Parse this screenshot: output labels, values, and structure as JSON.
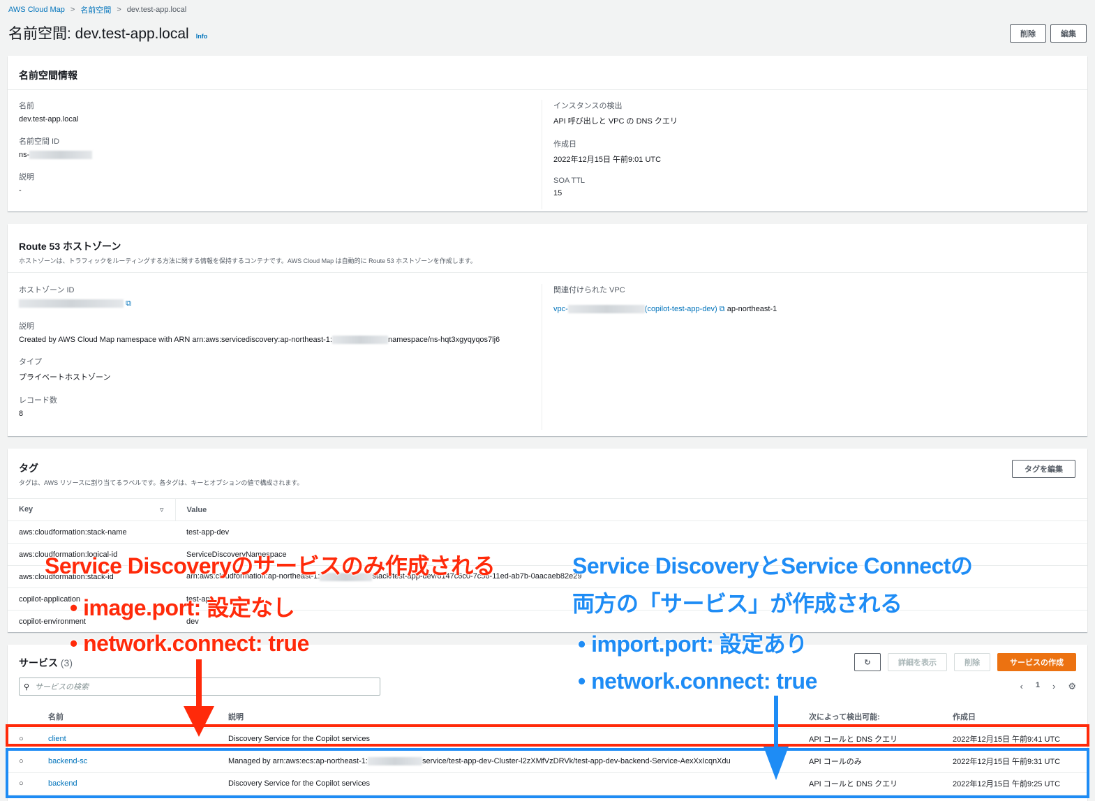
{
  "breadcrumb": [
    "AWS Cloud Map",
    "名前空間",
    "dev.test-app.local"
  ],
  "title": "名前空間: dev.test-app.local",
  "info": "Info",
  "header_buttons": {
    "delete": "削除",
    "edit": "編集"
  },
  "ns_info": {
    "heading": "名前空間情報",
    "left": [
      {
        "k": "名前",
        "v": "dev.test-app.local"
      },
      {
        "k": "名前空間 ID",
        "v": "ns-"
      },
      {
        "k": "説明",
        "v": "-"
      }
    ],
    "right": [
      {
        "k": "インスタンスの検出",
        "v": "API 呼び出しと VPC の DNS クエリ"
      },
      {
        "k": "作成日",
        "v": "2022年12月15日 午前9:01 UTC"
      },
      {
        "k": "SOA TTL",
        "v": "15"
      }
    ]
  },
  "route53": {
    "heading": "Route 53 ホストゾーン",
    "desc": "ホストゾーンは、トラフィックをルーティングする方法に関する情報を保持するコンテナです。AWS Cloud Map は自動的に Route 53 ホストゾーンを作成します。",
    "zone_id_label": "ホストゾーン ID",
    "desc_label": "説明",
    "desc_value_a": "Created by AWS Cloud Map namespace with ARN arn:aws:servicediscovery:ap-northeast-1:",
    "desc_value_b": "namespace/ns-hqt3xgyqyqos7lj6",
    "type_label": "タイプ",
    "type_value": "プライベートホストゾーン",
    "records_label": "レコード数",
    "records_value": "8",
    "vpc_label": "関連付けられた VPC",
    "vpc_prefix": "vpc-",
    "vpc_name": "(copilot-test-app-dev)",
    "vpc_region": "ap-northeast-1"
  },
  "tags": {
    "heading": "タグ",
    "desc": "タグは、AWS リソースに割り当てるラベルです。各タグは、キーとオプションの値で構成されます。",
    "edit": "タグを編集",
    "col_key": "Key",
    "col_value": "Value",
    "rows": [
      {
        "k": "aws:cloudformation:stack-name",
        "v": "test-app-dev"
      },
      {
        "k": "aws:cloudformation:logical-id",
        "v": "ServiceDiscoveryNamespace"
      },
      {
        "k": "aws:cloudformation:stack-id",
        "v": "arn:aws:cloudformation:ap-northeast-1:",
        "v2": "stack/test-app-dev/6147c6c0-7c56-11ed-ab7b-0aacaeb82e29"
      },
      {
        "k": "copilot-application",
        "v": "test-app"
      },
      {
        "k": "copilot-environment",
        "v": "dev"
      }
    ]
  },
  "services": {
    "heading": "サービス",
    "count": "(3)",
    "details": "詳細を表示",
    "delete": "削除",
    "create": "サービスの作成",
    "search_placeholder": "サービスの検索",
    "page": "1",
    "cols": [
      "名前",
      "説明",
      "次によって検出可能:",
      "作成日"
    ],
    "rows": [
      {
        "name": "client",
        "desc": "Discovery Service for the Copilot services",
        "disc": "API コールと DNS クエリ",
        "date": "2022年12月15日 午前9:41 UTC"
      },
      {
        "name": "backend-sc",
        "desc": "Managed by arn:aws:ecs:ap-northeast-1:",
        "desc2": "service/test-app-dev-Cluster-l2zXMfVzDRVk/test-app-dev-backend-Service-AexXxIcqnXdu",
        "disc": "API コールのみ",
        "date": "2022年12月15日 午前9:31 UTC"
      },
      {
        "name": "backend",
        "desc": "Discovery Service for the Copilot services",
        "disc": "API コールと DNS クエリ",
        "date": "2022年12月15日 午前9:25 UTC"
      }
    ]
  },
  "annotations": {
    "red": [
      "Service Discoveryのサービスのみ作成される",
      "• image.port: 設定なし",
      "• network.connect: true"
    ],
    "blue": [
      "Service DiscoveryとService Connectの",
      "両方の「サービス」が作成される",
      "• import.port: 設定あり",
      "• network.connect: true"
    ],
    "colors": {
      "red": "#ff2a0a",
      "blue": "#1e8cf5"
    }
  }
}
